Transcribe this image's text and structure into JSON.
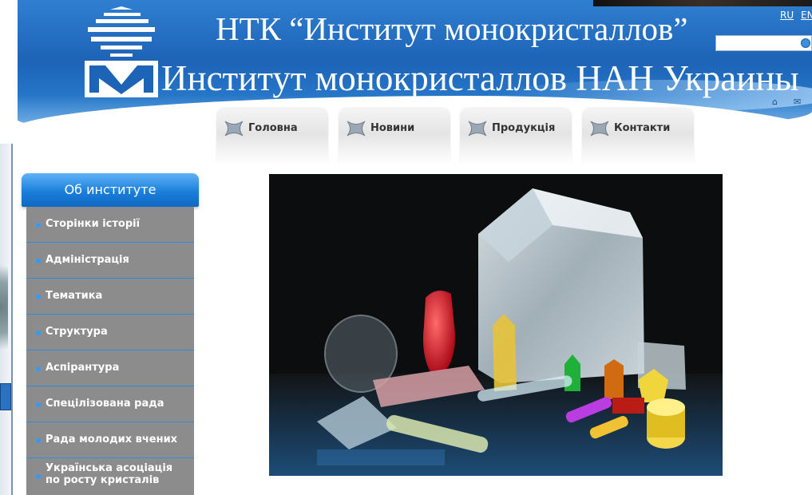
{
  "header": {
    "title_main": "НТК “Институт монокристаллов”",
    "title_sub": "Институт монокристаллов НАН Украины"
  },
  "lang": {
    "ru": "RU",
    "en": "EN"
  },
  "nav": [
    {
      "label": "Головна"
    },
    {
      "label": "Новини"
    },
    {
      "label": "Продукція"
    },
    {
      "label": "Контакти"
    }
  ],
  "sidebar": {
    "heading": "Об институте",
    "items": [
      {
        "label": "Сторінки історії"
      },
      {
        "label": "Адміністрація"
      },
      {
        "label": "Тематика"
      },
      {
        "label": "Структура"
      },
      {
        "label": "Аспірантура"
      },
      {
        "label": "Спецілізована рада"
      },
      {
        "label": "Рада молодих вчених"
      },
      {
        "label": "Українська асоціація по росту кристалів"
      }
    ]
  },
  "icons": {
    "logo": "institute-logo",
    "search": "search-icon",
    "home": "home-icon",
    "mail": "mail-icon",
    "nav": "star-x-icon"
  },
  "colors": {
    "header_blue": "#1d63b6",
    "sidebar_head": "#1b7fdb",
    "sidebar_bg": "#8c8c8c",
    "sidebar_bullet": "#2f9bff"
  }
}
